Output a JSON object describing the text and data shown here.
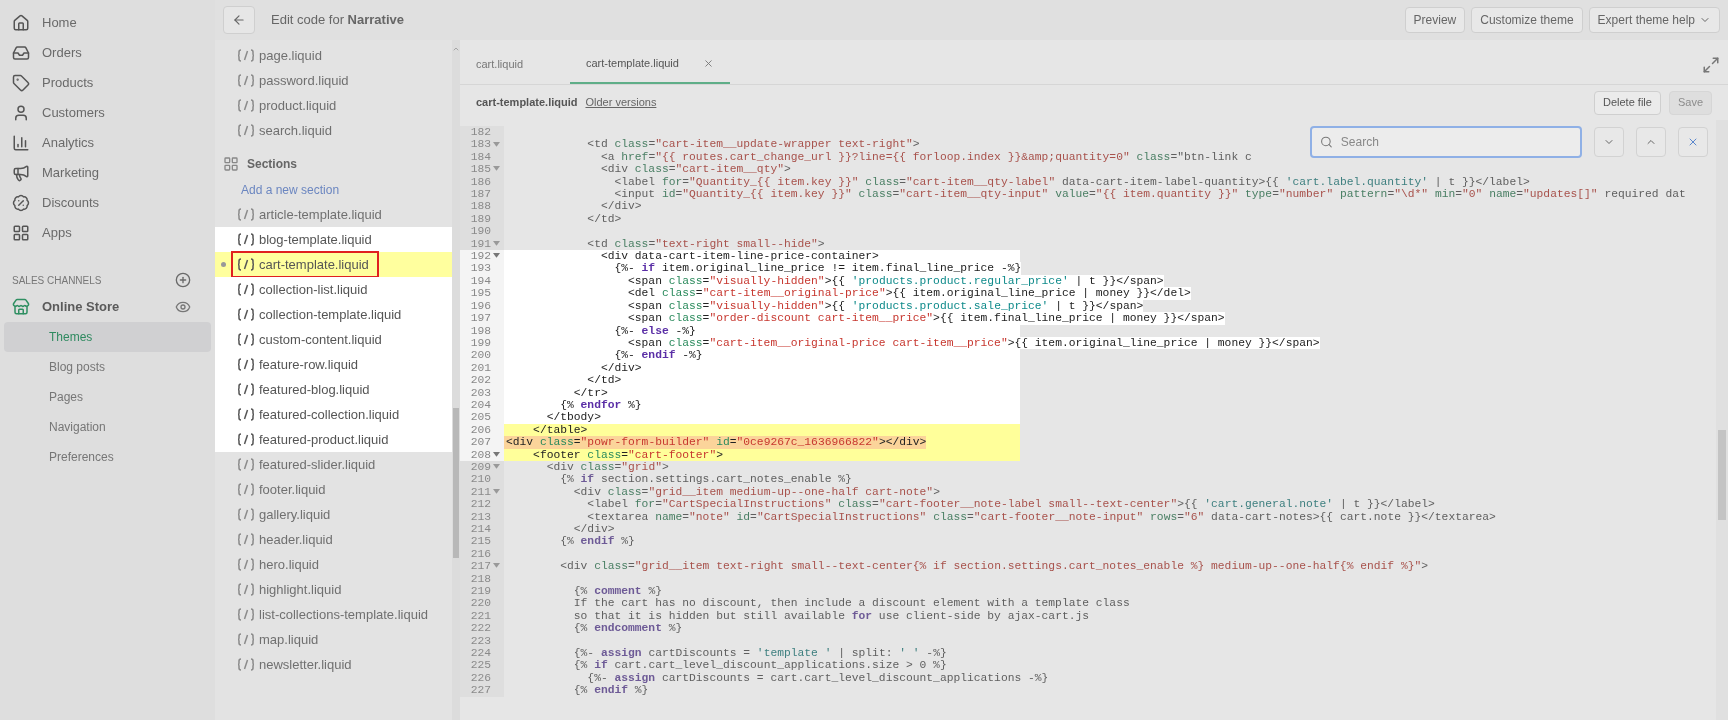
{
  "nav": {
    "items": [
      {
        "label": "Home",
        "selected": false
      },
      {
        "label": "Orders",
        "selected": false
      },
      {
        "label": "Products",
        "selected": false
      },
      {
        "label": "Customers",
        "selected": false
      },
      {
        "label": "Analytics",
        "selected": false
      },
      {
        "label": "Marketing",
        "selected": false
      },
      {
        "label": "Discounts",
        "selected": false
      },
      {
        "label": "Apps",
        "selected": false
      }
    ],
    "sales_channels": {
      "heading": "SALES CHANNELS",
      "channel": "Online Store",
      "sub_items": [
        {
          "label": "Themes",
          "selected": true
        },
        {
          "label": "Blog posts",
          "selected": false
        },
        {
          "label": "Pages",
          "selected": false
        },
        {
          "label": "Navigation",
          "selected": false
        },
        {
          "label": "Preferences",
          "selected": false
        }
      ]
    }
  },
  "topbar": {
    "title": "Edit code for **Narrative**",
    "buttons": [
      {
        "label": "Preview",
        "caret": false
      },
      {
        "label": "Customize theme",
        "caret": false
      },
      {
        "label": "Expert theme help",
        "caret": true
      }
    ]
  },
  "files": [
    {
      "kind": "file",
      "name": "page.liquid",
      "selected": false,
      "spotlight": false
    },
    {
      "kind": "file",
      "name": "password.liquid",
      "selected": false,
      "spotlight": false
    },
    {
      "kind": "file",
      "name": "product.liquid",
      "selected": false,
      "spotlight": false
    },
    {
      "kind": "file",
      "name": "search.liquid",
      "selected": false,
      "spotlight": false
    },
    {
      "kind": "heading",
      "name": "Sections",
      "selected": false,
      "spotlight": false
    },
    {
      "kind": "link",
      "name": "Add a new section",
      "selected": false,
      "spotlight": false
    },
    {
      "kind": "file",
      "name": "article-template.liquid",
      "selected": false,
      "spotlight": false
    },
    {
      "kind": "file",
      "name": "blog-template.liquid",
      "selected": false,
      "spotlight": true
    },
    {
      "kind": "file",
      "name": "cart-template.liquid",
      "selected": true,
      "spotlight": true
    },
    {
      "kind": "file",
      "name": "collection-list.liquid",
      "selected": false,
      "spotlight": true
    },
    {
      "kind": "file",
      "name": "collection-template.liquid",
      "selected": false,
      "spotlight": true
    },
    {
      "kind": "file",
      "name": "custom-content.liquid",
      "selected": false,
      "spotlight": true
    },
    {
      "kind": "file",
      "name": "feature-row.liquid",
      "selected": false,
      "spotlight": true
    },
    {
      "kind": "file",
      "name": "featured-blog.liquid",
      "selected": false,
      "spotlight": true
    },
    {
      "kind": "file",
      "name": "featured-collection.liquid",
      "selected": false,
      "spotlight": true
    },
    {
      "kind": "file",
      "name": "featured-product.liquid",
      "selected": false,
      "spotlight": true
    },
    {
      "kind": "file",
      "name": "featured-slider.liquid",
      "selected": false,
      "spotlight": false
    },
    {
      "kind": "file",
      "name": "footer.liquid",
      "selected": false,
      "spotlight": false
    },
    {
      "kind": "file",
      "name": "gallery.liquid",
      "selected": false,
      "spotlight": false
    },
    {
      "kind": "file",
      "name": "header.liquid",
      "selected": false,
      "spotlight": false
    },
    {
      "kind": "file",
      "name": "hero.liquid",
      "selected": false,
      "spotlight": false
    },
    {
      "kind": "file",
      "name": "highlight.liquid",
      "selected": false,
      "spotlight": false
    },
    {
      "kind": "file",
      "name": "list-collections-template.liquid",
      "selected": false,
      "spotlight": false
    },
    {
      "kind": "file",
      "name": "map.liquid",
      "selected": false,
      "spotlight": false
    },
    {
      "kind": "file",
      "name": "newsletter.liquid",
      "selected": false,
      "spotlight": false
    }
  ],
  "tabs": [
    {
      "label": "cart.liquid",
      "selected": false,
      "closable": false
    },
    {
      "label": "cart-template.liquid",
      "selected": true,
      "closable": true
    }
  ],
  "file_bar": {
    "filename": "cart-template.liquid",
    "link": "Older versions",
    "buttons": [
      {
        "label": "Delete file",
        "disabled": false
      },
      {
        "label": "Save",
        "disabled": true
      }
    ]
  },
  "search": {
    "placeholder": "Search"
  },
  "code_lines": [
    {
      "no": "182",
      "fold": false,
      "spotlight": false,
      "highlighted": false,
      "marked": false
    },
    {
      "no": "183",
      "text": "            <td class=\"cart-item__update-wrapper text-right\">",
      "fold": true,
      "spotlight": false,
      "highlighted": false,
      "marked": false
    },
    {
      "no": "184",
      "text": "              <a href=\"{{ routes.cart_change_url }}?line={{ forloop.index }}&amp;quantity=0\" class=\"btn-link c",
      "fold": false,
      "spotlight": false,
      "highlighted": false,
      "marked": false
    },
    {
      "no": "185",
      "text": "              <div class=\"cart-item__qty\">",
      "fold": true,
      "spotlight": false,
      "highlighted": false,
      "marked": false
    },
    {
      "no": "186",
      "text": "                <label for=\"Quantity_{{ item.key }}\" class=\"cart-item__qty-label\" data-cart-item-label-quantity>{{ 'cart.label.quantity' | t }}</label>",
      "fold": false,
      "spotlight": false,
      "highlighted": false,
      "marked": false
    },
    {
      "no": "187",
      "text": "                <input id=\"Quantity_{{ item.key }}\" class=\"cart-item__qty-input\" value=\"{{ item.quantity }}\" type=\"number\" pattern=\"\\d*\" min=\"0\" name=\"updates[]\" required dat",
      "fold": false,
      "spotlight": false,
      "highlighted": false,
      "marked": false
    },
    {
      "no": "188",
      "text": "              </div>",
      "fold": false,
      "spotlight": false,
      "highlighted": false,
      "marked": false
    },
    {
      "no": "189",
      "text": "            </td>",
      "fold": false,
      "spotlight": false,
      "highlighted": false,
      "marked": false
    },
    {
      "no": "190",
      "fold": false,
      "spotlight": false,
      "highlighted": false,
      "marked": false
    },
    {
      "no": "191",
      "text": "            <td class=\"text-right small--hide\">",
      "fold": true,
      "spotlight": false,
      "highlighted": false,
      "marked": false
    },
    {
      "no": "192",
      "text": "              <div data-cart-item-line-price-container>",
      "fold": true,
      "spotlight": true,
      "highlighted": false,
      "marked": false
    },
    {
      "no": "193",
      "text": "                {%- if item.original_line_price != item.final_line_price -%}",
      "fold": false,
      "spotlight": true,
      "highlighted": false,
      "marked": false
    },
    {
      "no": "194",
      "text": "                  <span class=\"visually-hidden\">{{ 'products.product.regular_price' | t }}</span>",
      "fold": false,
      "spotlight": true,
      "highlighted": false,
      "marked": false
    },
    {
      "no": "195",
      "text": "                  <del class=\"cart-item__original-price\">{{ item.original_line_price | money }}</del>",
      "fold": false,
      "spotlight": true,
      "highlighted": false,
      "marked": false
    },
    {
      "no": "196",
      "text": "                  <span class=\"visually-hidden\">{{ 'products.product.sale_price' | t }}</span>",
      "fold": false,
      "spotlight": true,
      "highlighted": false,
      "marked": false
    },
    {
      "no": "197",
      "text": "                  <span class=\"order-discount cart-item__price\">{{ item.final_line_price | money }}</span>",
      "fold": false,
      "spotlight": true,
      "highlighted": false,
      "marked": false
    },
    {
      "no": "198",
      "text": "                {%- else -%}",
      "fold": false,
      "spotlight": true,
      "highlighted": false,
      "marked": false
    },
    {
      "no": "199",
      "text": "                  <span class=\"cart-item__original-price cart-item__price\">{{ item.original_line_price | money }}</span>",
      "fold": false,
      "spotlight": true,
      "highlighted": false,
      "marked": false
    },
    {
      "no": "200",
      "text": "                {%- endif -%}",
      "fold": false,
      "spotlight": true,
      "highlighted": false,
      "marked": false
    },
    {
      "no": "201",
      "text": "              </div>",
      "fold": false,
      "spotlight": true,
      "highlighted": false,
      "marked": false
    },
    {
      "no": "202",
      "text": "            </td>",
      "fold": false,
      "spotlight": true,
      "highlighted": false,
      "marked": false
    },
    {
      "no": "203",
      "text": "          </tr>",
      "fold": false,
      "spotlight": true,
      "highlighted": false,
      "marked": false
    },
    {
      "no": "204",
      "text": "        {% endfor %}",
      "fold": false,
      "spotlight": true,
      "highlighted": false,
      "marked": false
    },
    {
      "no": "205",
      "text": "      </tbody>",
      "fold": false,
      "spotlight": true,
      "highlighted": false,
      "marked": false
    },
    {
      "no": "206",
      "text": "    </table>",
      "fold": false,
      "spotlight": true,
      "highlighted": true,
      "marked": false
    },
    {
      "no": "207",
      "text": "<div class=\"powr-form-builder\" id=\"0ce9267c_1636966822\"></div>",
      "fold": false,
      "spotlight": true,
      "highlighted": true,
      "marked": true
    },
    {
      "no": "208",
      "text": "    <footer class=\"cart-footer\">",
      "fold": true,
      "spotlight": true,
      "highlighted": true,
      "marked": false
    },
    {
      "no": "209",
      "text": "      <div class=\"grid\">",
      "fold": true,
      "spotlight": false,
      "highlighted": false,
      "marked": false
    },
    {
      "no": "210",
      "text": "        {% if section.settings.cart_notes_enable %}",
      "fold": false,
      "spotlight": false,
      "highlighted": false,
      "marked": false
    },
    {
      "no": "211",
      "text": "          <div class=\"grid__item medium-up--one-half cart-note\">",
      "fold": true,
      "spotlight": false,
      "highlighted": false,
      "marked": false
    },
    {
      "no": "212",
      "text": "            <label for=\"CartSpecialInstructions\" class=\"cart-footer__note-label small--text-center\">{{ 'cart.general.note' | t }}</label>",
      "fold": false,
      "spotlight": false,
      "highlighted": false,
      "marked": false
    },
    {
      "no": "213",
      "text": "            <textarea name=\"note\" id=\"CartSpecialInstructions\" class=\"cart-footer__note-input\" rows=\"6\" data-cart-notes>{{ cart.note }}</textarea>",
      "fold": false,
      "spotlight": false,
      "highlighted": false,
      "marked": false
    },
    {
      "no": "214",
      "text": "          </div>",
      "fold": false,
      "spotlight": false,
      "highlighted": false,
      "marked": false
    },
    {
      "no": "215",
      "text": "        {% endif %}",
      "fold": false,
      "spotlight": false,
      "highlighted": false,
      "marked": false
    },
    {
      "no": "216",
      "fold": false,
      "spotlight": false,
      "highlighted": false,
      "marked": false
    },
    {
      "no": "217",
      "text": "        <div class=\"grid__item text-right small--text-center{% if section.settings.cart_notes_enable %} medium-up--one-half{% endif %}\">",
      "fold": true,
      "spotlight": false,
      "highlighted": false,
      "marked": false
    },
    {
      "no": "218",
      "fold": false,
      "spotlight": false,
      "highlighted": false,
      "marked": false
    },
    {
      "no": "219",
      "text": "          {% comment %}",
      "fold": false,
      "spotlight": false,
      "highlighted": false,
      "marked": false
    },
    {
      "no": "220",
      "text": "          If the cart has no discount, then include a discount element with a template class",
      "fold": false,
      "spotlight": false,
      "highlighted": false,
      "marked": false
    },
    {
      "no": "221",
      "text": "          so that it is hidden but still available for use client-side by ajax-cart.js",
      "fold": false,
      "spotlight": false,
      "highlighted": false,
      "marked": false
    },
    {
      "no": "222",
      "text": "          {% endcomment %}",
      "fold": false,
      "spotlight": false,
      "highlighted": false,
      "marked": false
    },
    {
      "no": "223",
      "fold": false,
      "spotlight": false,
      "highlighted": false,
      "marked": false
    },
    {
      "no": "224",
      "text": "          {%- assign cartDiscounts = 'template ' | split: ' ' -%}",
      "fold": false,
      "spotlight": false,
      "highlighted": false,
      "marked": false
    },
    {
      "no": "225",
      "text": "          {% if cart.cart_level_discount_applications.size > 0 %}",
      "fold": false,
      "spotlight": false,
      "highlighted": false,
      "marked": false
    },
    {
      "no": "226",
      "text": "            {%- assign cartDiscounts = cart.cart_level_discount_applications -%}",
      "fold": false,
      "spotlight": false,
      "highlighted": false,
      "marked": false
    },
    {
      "no": "227",
      "text": "          {% endif %}",
      "fold": false,
      "spotlight": false,
      "highlighted": false,
      "marked": false
    }
  ]
}
